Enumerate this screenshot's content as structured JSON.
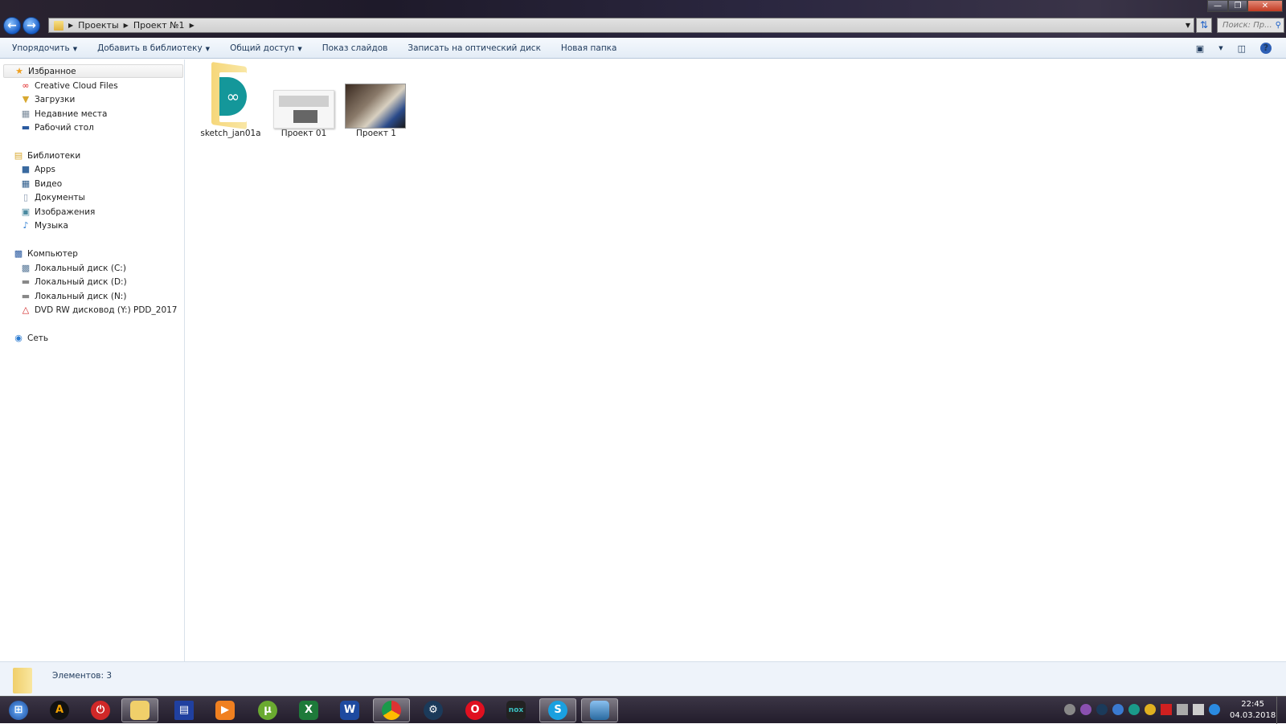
{
  "window": {
    "breadcrumb": [
      "Проекты",
      "Проект №1"
    ],
    "search_placeholder": "Поиск: Пр...",
    "back_icon": "arrow-left",
    "forward_icon": "arrow-right"
  },
  "toolbar": {
    "items": [
      {
        "label": "Упорядочить",
        "dropdown": true
      },
      {
        "label": "Добавить в библиотеку",
        "dropdown": true
      },
      {
        "label": "Общий доступ",
        "dropdown": true
      },
      {
        "label": "Показ слайдов"
      },
      {
        "label": "Записать на оптический диск"
      },
      {
        "label": "Новая папка"
      }
    ]
  },
  "sidebar": {
    "favorites": {
      "label": "Избранное",
      "items": [
        "Creative Cloud Files",
        "Загрузки",
        "Недавние места",
        "Рабочий стол"
      ]
    },
    "libraries": {
      "label": "Библиотеки",
      "items": [
        "Apps",
        "Видео",
        "Документы",
        "Изображения",
        "Музыка"
      ]
    },
    "computer": {
      "label": "Компьютер",
      "items": [
        "Локальный диск (C:)",
        "Локальный диск (D:)",
        "Локальный диск (N:)",
        "DVD RW дисковод (Y:) PDD_2017"
      ]
    },
    "network": {
      "label": "Сеть"
    }
  },
  "files": [
    {
      "name": "sketch_jan01a",
      "type": "folder"
    },
    {
      "name": "Проект 01",
      "type": "image"
    },
    {
      "name": "Проект 1",
      "type": "photo"
    }
  ],
  "status": {
    "count_text": "Элементов: 3"
  },
  "taskbar": {
    "apps": [
      "start",
      "aimp",
      "power",
      "explorer",
      "save",
      "media-player",
      "utorrent",
      "excel",
      "word",
      "chrome",
      "steam",
      "opera",
      "nox",
      "skype",
      "photos"
    ],
    "time": "22:45",
    "date": "04.03.2018"
  },
  "colors": {
    "accent": "#1e395b",
    "taskbar": "#2a2433"
  }
}
